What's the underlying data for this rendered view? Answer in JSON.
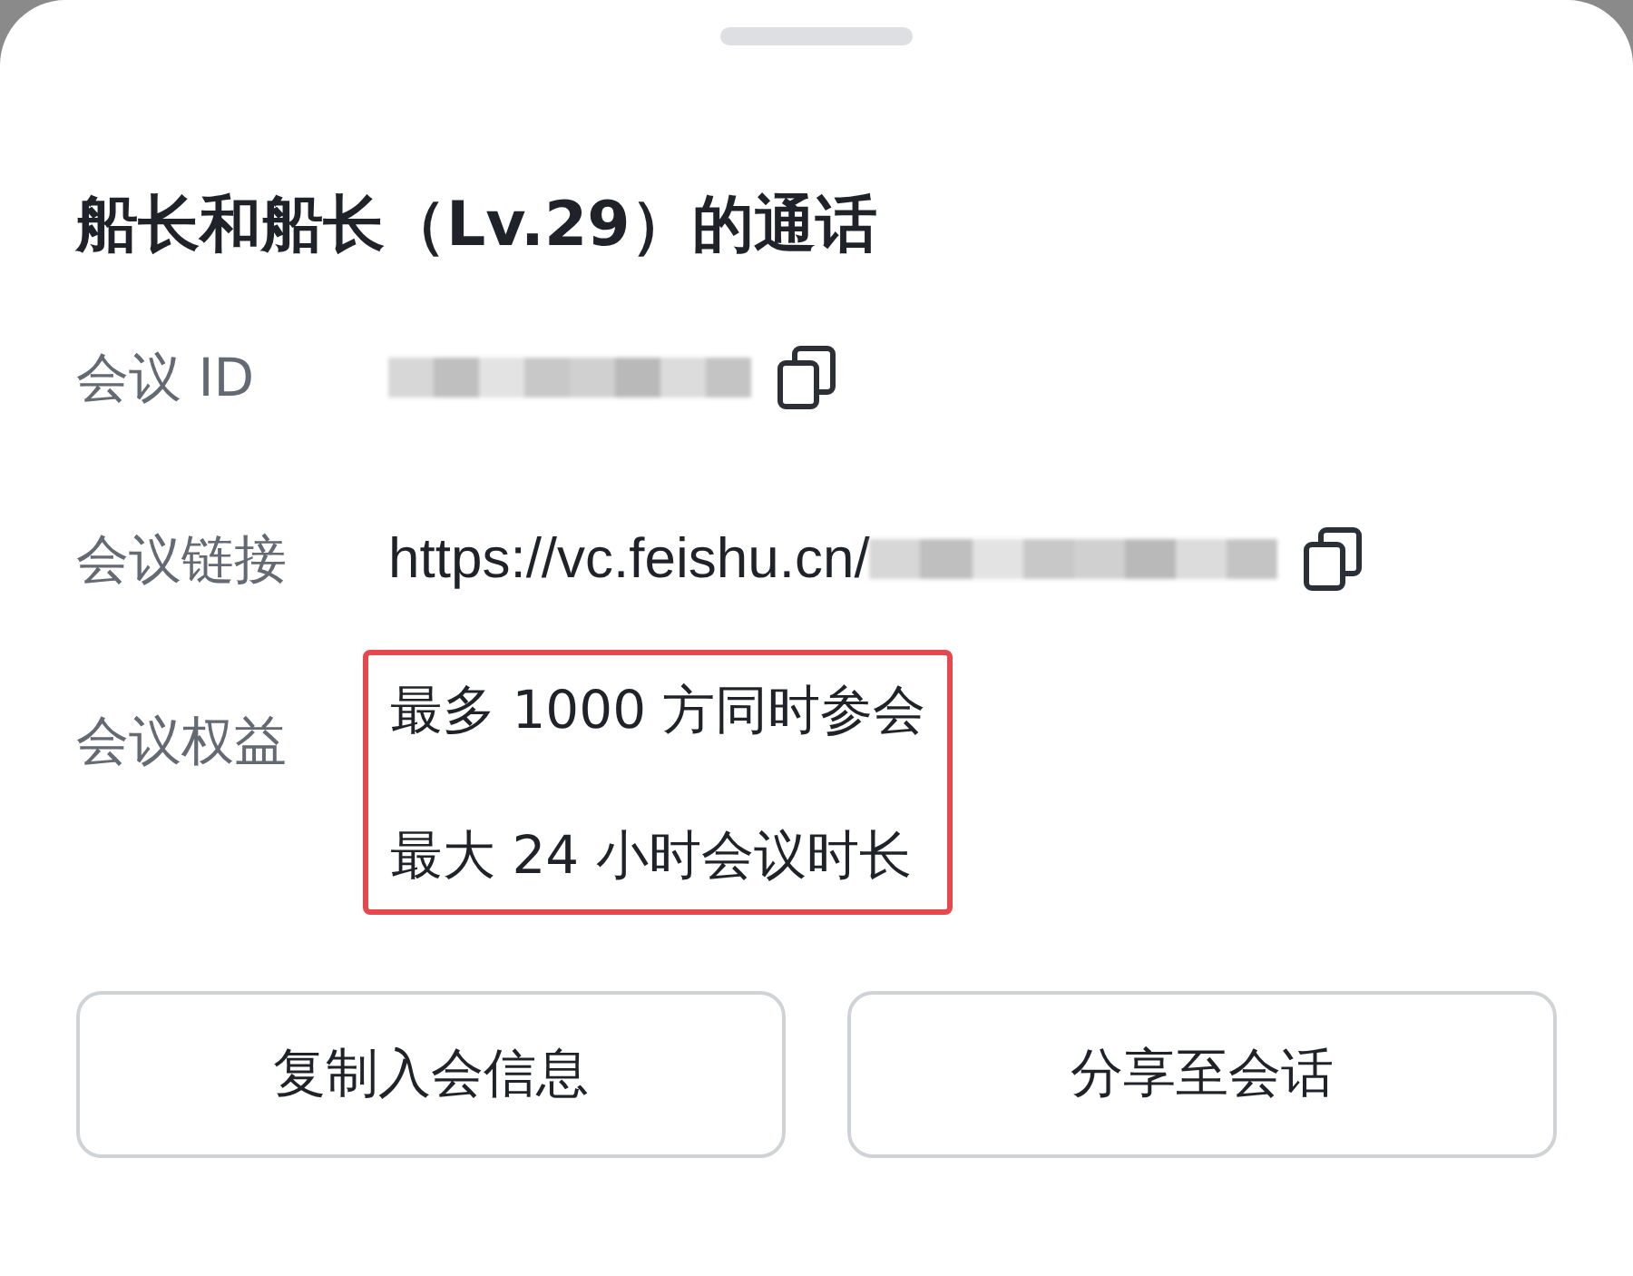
{
  "title": "船长和船长（Lv.29）的通话",
  "rows": [
    {
      "kind": "link",
      "label": "会议 ID",
      "redacted": true,
      "copyable": true
    },
    {
      "kind": "link",
      "label": "会议链接",
      "value": "https://vc.feishu.cn/",
      "redacted": true,
      "copyable": true
    },
    {
      "kind": "list",
      "label": "会议权益",
      "highlighted": true,
      "items": [
        "最多 1000 方同时参会",
        "最大 24 小时会议时长"
      ]
    }
  ],
  "buttons": [
    "复制入会信息",
    "分享至会话"
  ]
}
